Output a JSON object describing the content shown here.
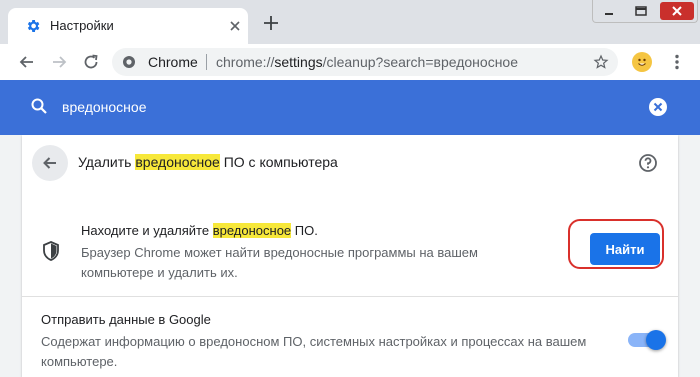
{
  "tab": {
    "title": "Настройки",
    "favicon": "gear-icon"
  },
  "toolbar": {
    "omnibox_site_label": "Chrome",
    "url_scheme": "chrome://",
    "url_host": "settings",
    "url_path": "/cleanup?search=вредоносное"
  },
  "search": {
    "query": "вредоносное"
  },
  "page": {
    "title_before": "Удалить ",
    "title_highlight": "вредоносное",
    "title_after": " ПО с компьютера"
  },
  "find": {
    "title_before": "Находите и удаляйте ",
    "title_highlight": "вредоносное",
    "title_after": " ПО.",
    "description": "Браузер Chrome может найти вредоносные программы на вашем компьютере и удалить их.",
    "button_label": "Найти"
  },
  "send_data": {
    "title": "Отправить данные в Google",
    "description": "Содержат информацию о вредоносном ПО, системных настройках и процессах на вашем компьютере.",
    "enabled": true
  },
  "colors": {
    "accent": "#1a73e8",
    "search_bar": "#3b70d8",
    "highlight": "#f7e83a",
    "annotation_outline": "#d9302b"
  }
}
